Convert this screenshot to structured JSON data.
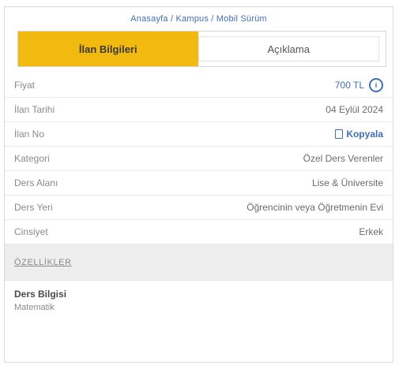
{
  "breadcrumb": "Anasayfa / Kampus / Mobil Sürüm",
  "tabs": [
    {
      "label": "İlan Bilgileri",
      "active": true
    },
    {
      "label": "Açıklama",
      "active": false
    }
  ],
  "rows": [
    {
      "label": "Fiyat",
      "value": "700 TL",
      "icon": "info-icon"
    },
    {
      "label": "İlan Tarihi",
      "value": "04 Eylül 2024"
    },
    {
      "label": "İlan No",
      "value": "Kopyala",
      "icon": "copy-icon"
    },
    {
      "label": "Kategori",
      "value": "Özel Ders Verenler"
    },
    {
      "label": "Ders Alanı",
      "value": "Lise & Üniversite"
    },
    {
      "label": "Ders Yeri",
      "value": "Öğrencinin veya Öğretmenin Evi"
    },
    {
      "label": "Cinsiyet",
      "value": "Erkek"
    }
  ],
  "section": {
    "title": "ÖZELLİKLER"
  },
  "feature": {
    "title": "Ders Bilgisi",
    "subtitle": "Matematik"
  },
  "colors": {
    "accent": "#f2b90f",
    "link": "#3f6fb5",
    "section_bg": "#eeeeee"
  }
}
